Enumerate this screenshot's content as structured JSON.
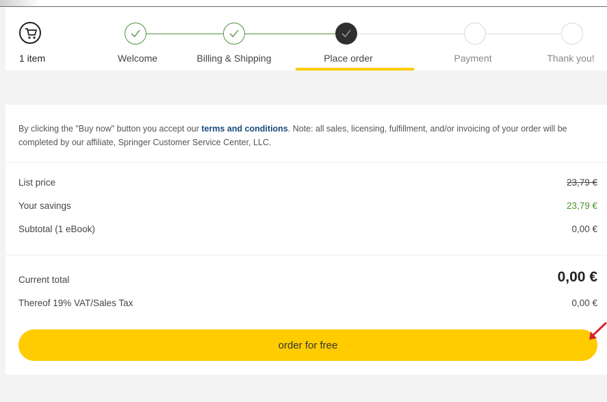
{
  "header": {
    "cart_count_label": "1 item",
    "steps": [
      {
        "label": "Welcome",
        "state": "done"
      },
      {
        "label": "Billing & Shipping",
        "state": "done"
      },
      {
        "label": "Place order",
        "state": "active"
      },
      {
        "label": "Payment",
        "state": "todo"
      },
      {
        "label": "Thank you!",
        "state": "todo"
      }
    ]
  },
  "notice": {
    "text_before": "By clicking the \"Buy now\" button you accept our ",
    "link": "terms and conditions",
    "text_after": ". Note: all sales, licensing, fulfillment, and/or invoicing of your order will be completed by our affiliate, Springer Customer Service Center, LLC."
  },
  "summary": {
    "list_price_label": "List price",
    "list_price_value": "23,79 €",
    "savings_label": "Your savings",
    "savings_value": "23,79 €",
    "subtotal_label": "Subtotal (1 eBook)",
    "subtotal_value": "0,00 €",
    "current_total_label": "Current total",
    "current_total_value": "0,00 €",
    "vat_label": "Thereof 19% VAT/Sales Tax",
    "vat_value": "0,00 €"
  },
  "order_button_label": "order for free",
  "colors": {
    "accent_yellow": "#fecc00",
    "step_green": "#4d8f3c",
    "savings_green": "#4c8f2f",
    "link_blue": "#1a4b7c",
    "annotation_red": "#d9232d"
  }
}
